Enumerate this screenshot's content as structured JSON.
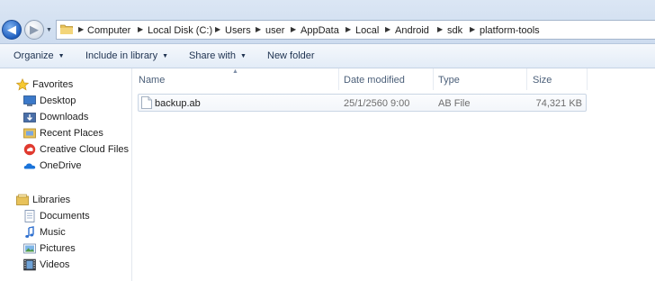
{
  "address_bar": {
    "breadcrumbs": [
      "Computer",
      "Local Disk (C:)",
      "Users",
      "user",
      "AppData",
      "Local",
      "Android",
      "sdk",
      "platform-tools"
    ]
  },
  "toolbar": {
    "organize": "Organize",
    "include_in_library": "Include in library",
    "share_with": "Share with",
    "new_folder": "New folder"
  },
  "nav": {
    "favorites": {
      "header": "Favorites",
      "items": [
        "Desktop",
        "Downloads",
        "Recent Places",
        "Creative Cloud Files",
        "OneDrive"
      ]
    },
    "libraries": {
      "header": "Libraries",
      "items": [
        "Documents",
        "Music",
        "Pictures",
        "Videos"
      ]
    }
  },
  "columns": {
    "name": "Name",
    "date_modified": "Date modified",
    "type": "Type",
    "size": "Size"
  },
  "files": [
    {
      "name": "backup.ab",
      "date_modified": "25/1/2560 9:00",
      "type": "AB File",
      "size": "74,321 KB"
    }
  ],
  "colors": {
    "accent": "#1f5fbf",
    "toolbar_text": "#1e3250",
    "column_header_text": "#4c607a",
    "secondary_text": "#6d6d6d"
  }
}
